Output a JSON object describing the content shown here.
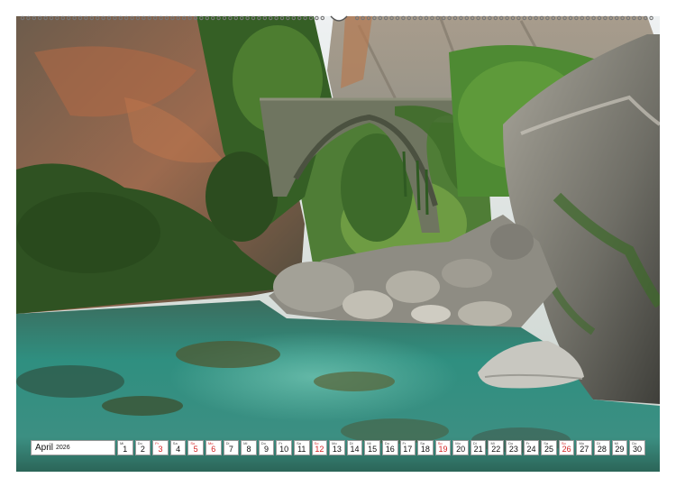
{
  "calendar": {
    "month": "April",
    "year": "2026",
    "days": [
      {
        "n": "1",
        "d": "Mi",
        "sun": false
      },
      {
        "n": "2",
        "d": "Do",
        "sun": false
      },
      {
        "n": "3",
        "d": "Fr",
        "sun": true
      },
      {
        "n": "4",
        "d": "Sa",
        "sun": false
      },
      {
        "n": "5",
        "d": "So",
        "sun": true
      },
      {
        "n": "6",
        "d": "Mo",
        "sun": true
      },
      {
        "n": "7",
        "d": "Di",
        "sun": false
      },
      {
        "n": "8",
        "d": "Mi",
        "sun": false
      },
      {
        "n": "9",
        "d": "Do",
        "sun": false
      },
      {
        "n": "10",
        "d": "Fr",
        "sun": false
      },
      {
        "n": "11",
        "d": "Sa",
        "sun": false
      },
      {
        "n": "12",
        "d": "So",
        "sun": true
      },
      {
        "n": "13",
        "d": "Mo",
        "sun": false
      },
      {
        "n": "14",
        "d": "Di",
        "sun": false
      },
      {
        "n": "15",
        "d": "Mi",
        "sun": false
      },
      {
        "n": "16",
        "d": "Do",
        "sun": false
      },
      {
        "n": "17",
        "d": "Fr",
        "sun": false
      },
      {
        "n": "18",
        "d": "Sa",
        "sun": false
      },
      {
        "n": "19",
        "d": "So",
        "sun": true
      },
      {
        "n": "20",
        "d": "Mo",
        "sun": false
      },
      {
        "n": "21",
        "d": "Di",
        "sun": false
      },
      {
        "n": "22",
        "d": "Mi",
        "sun": false
      },
      {
        "n": "23",
        "d": "Do",
        "sun": false
      },
      {
        "n": "24",
        "d": "Fr",
        "sun": false
      },
      {
        "n": "25",
        "d": "Sa",
        "sun": false
      },
      {
        "n": "26",
        "d": "So",
        "sun": true
      },
      {
        "n": "27",
        "d": "Mo",
        "sun": false
      },
      {
        "n": "28",
        "d": "Di",
        "sun": false
      },
      {
        "n": "29",
        "d": "Mi",
        "sun": false
      },
      {
        "n": "30",
        "d": "Do",
        "sun": false
      }
    ]
  },
  "colors": {
    "sunday": "#d22222",
    "water": "#2f8f80",
    "foliage": "#3e6f2a",
    "rock": "#8a8a82"
  }
}
